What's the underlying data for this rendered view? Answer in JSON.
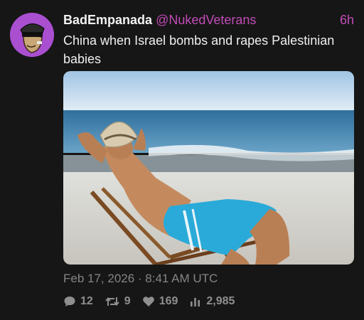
{
  "tweet": {
    "display_name": "BadEmpanada",
    "handle": "@NukedVeterans",
    "time_ago": "6h",
    "text": "China when Israel bombs and rapes Palestinian babies",
    "timestamp": "Feb 17, 2026 · 8:41 AM UTC",
    "stats": {
      "replies": "12",
      "retweets": "9",
      "likes": "169",
      "views": "2,985"
    }
  },
  "icons": {
    "avatar": "cartoon-character-avatar",
    "replies": "speech-bubble-icon",
    "retweets": "retweet-icon",
    "likes": "heart-icon",
    "views": "bar-chart-icon"
  },
  "colors": {
    "background": "#161616",
    "accent": "#c24bb7",
    "avatar_bg": "#a94fd0",
    "muted": "#858585"
  }
}
